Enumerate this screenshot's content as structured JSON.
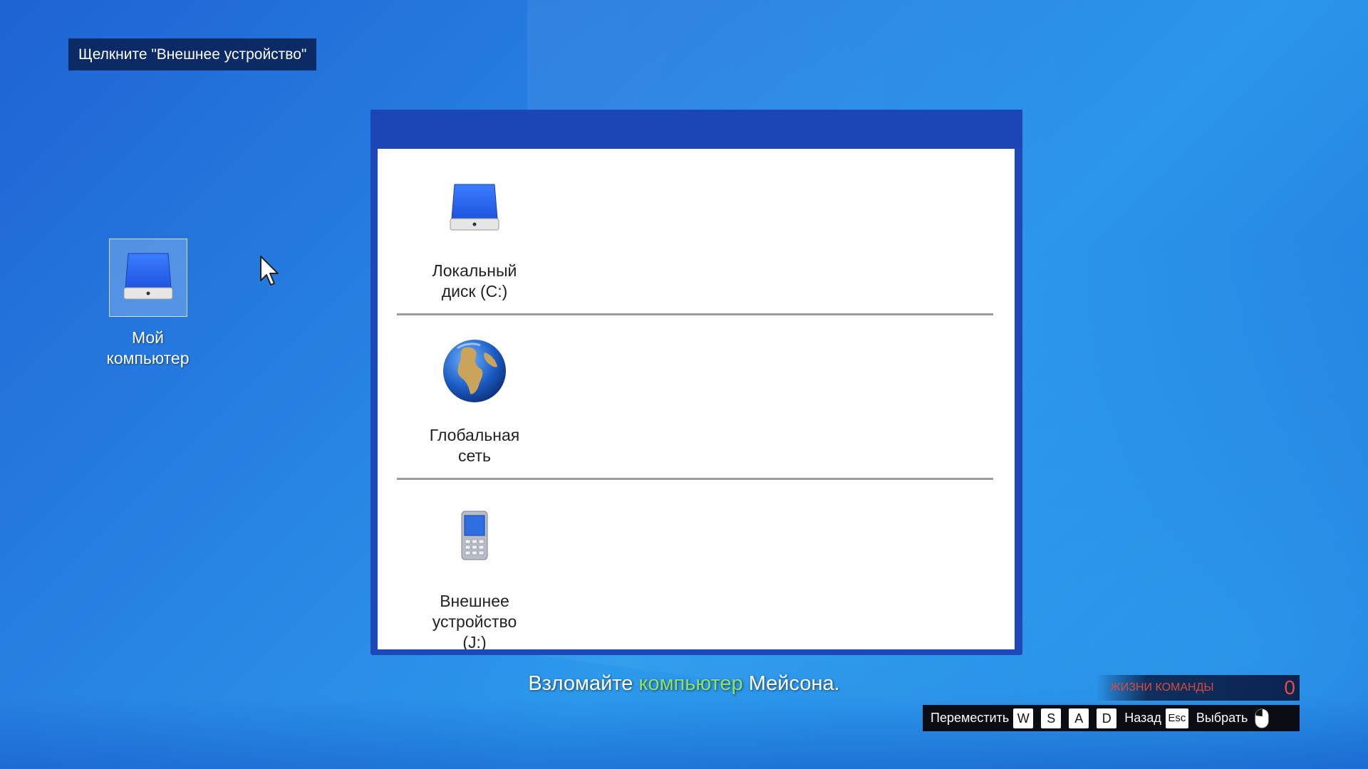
{
  "hint": {
    "text": "Щелкните \"Внешнее устройство\""
  },
  "desktop": {
    "my_computer": {
      "label": "Мой\nкомпьютер",
      "icon": "hard-drive-icon"
    }
  },
  "window": {
    "items": [
      {
        "label": "Локальный\nдиск (C:)",
        "icon": "hard-drive-icon"
      },
      {
        "label": "Глобальная\nсеть",
        "icon": "globe-icon"
      },
      {
        "label": "Внешнее\nустройство\n(J:)",
        "icon": "mobile-phone-icon"
      }
    ]
  },
  "objective": {
    "before": "Взломайте ",
    "highlight": "компьютер",
    "after": " Мейсона.",
    "highlight_color": "#8fe06a"
  },
  "team_lives": {
    "label": "ЖИЗНИ КОМАНДЫ",
    "value": "0",
    "color": "#e0503c"
  },
  "controls": {
    "move_label": "Переместить",
    "keys": [
      "W",
      "S",
      "A",
      "D"
    ],
    "back_label": "Назад",
    "back_key": "Esc",
    "select_label": "Выбрать",
    "select_icon": "mouse-icon"
  }
}
